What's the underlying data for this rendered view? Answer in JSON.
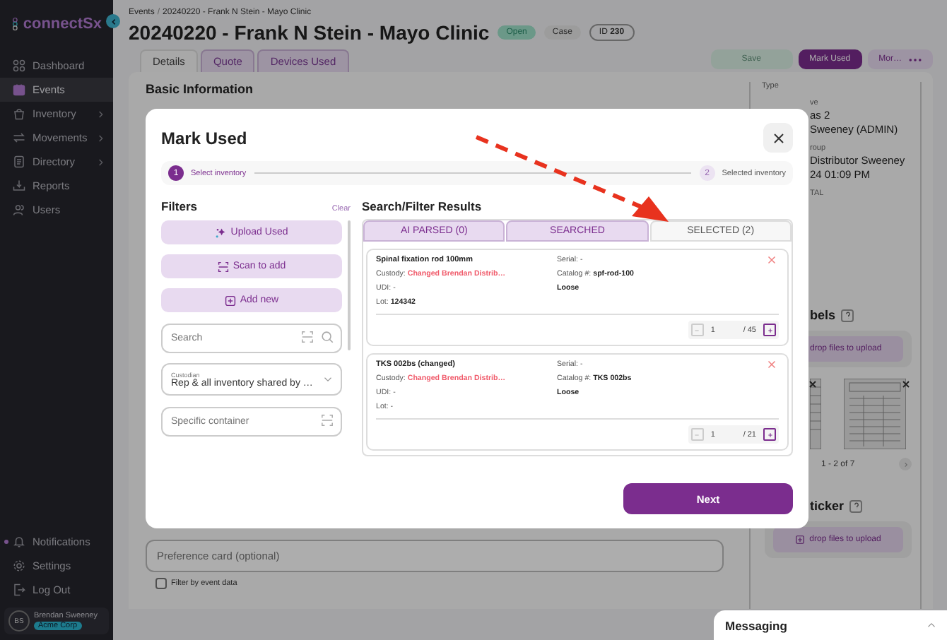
{
  "sidebar": {
    "logo": "connectSx",
    "items": [
      {
        "label": "Dashboard",
        "selected": false,
        "chevron": false
      },
      {
        "label": "Events",
        "selected": true,
        "chevron": false
      },
      {
        "label": "Inventory",
        "selected": false,
        "chevron": true
      },
      {
        "label": "Movements",
        "selected": false,
        "chevron": true
      },
      {
        "label": "Directory",
        "selected": false,
        "chevron": true
      },
      {
        "label": "Reports",
        "selected": false,
        "chevron": false
      },
      {
        "label": "Users",
        "selected": false,
        "chevron": false
      }
    ],
    "bottom_items": [
      {
        "label": "Notifications",
        "unread": true
      },
      {
        "label": "Settings",
        "unread": false
      },
      {
        "label": "Log Out",
        "unread": false
      }
    ],
    "user": {
      "initials": "BS",
      "name": "Brendan Sweeney",
      "org": "Acme Corp"
    }
  },
  "header": {
    "breadcrumb": [
      {
        "text": "Events",
        "kind": "link"
      },
      {
        "text": "/",
        "kind": "separator"
      },
      {
        "text": "20240220 - Frank N Stein - Mayo Clinic",
        "kind": "link"
      }
    ],
    "title": "20240220 - Frank N Stein - Mayo Clinic",
    "badges": [
      {
        "text": "Open",
        "kind": "status"
      },
      {
        "text": "Case",
        "kind": "plain"
      },
      {
        "text": "ID **230**",
        "kind": "outline"
      }
    ],
    "tabs": [
      {
        "label": "Details",
        "selected": true
      },
      {
        "label": "Quote",
        "selected": false
      },
      {
        "label": "Devices Used",
        "selected": false
      }
    ],
    "actions": [
      {
        "label": "Save",
        "kind": "save",
        "disabled": true
      },
      {
        "label": "Mark Used",
        "kind": "primary",
        "disabled": false
      },
      {
        "label": "Mor…",
        "kind": "more",
        "disabled": false
      }
    ]
  },
  "page": {
    "section_title": "Basic Information",
    "preference_placeholder": "Preference card (optional)",
    "filter_checkbox": {
      "label": "Filter by event data",
      "checked": false
    },
    "side_fields": [
      {
        "text": "Type",
        "kind": "label"
      },
      {
        "text": "ve",
        "kind": "label"
      },
      {
        "text": "as 2",
        "kind": "value"
      },
      {
        "text": "Sweeney (ADMIN)",
        "kind": "value"
      },
      {
        "text": "roup",
        "kind": "label"
      },
      {
        "text": "Distributor Sweeney",
        "kind": "value"
      },
      {
        "text": "24 01:09 PM",
        "kind": "value"
      },
      {
        "text": "TAL",
        "kind": "label"
      }
    ],
    "labels_title": "bels",
    "labels_upload": "drop files to upload",
    "labels_pager": "1 - 2 of 7",
    "sticker_title": "ticker",
    "sticker_upload": "drop files to upload"
  },
  "modal": {
    "title": "Mark Used",
    "steps": [
      {
        "number": "1",
        "label": "Select inventory",
        "selected": true
      },
      {
        "number": "2",
        "label": "Selected inventory",
        "selected": false
      }
    ],
    "filters": {
      "title": "Filters",
      "clear": "Clear",
      "buttons": [
        {
          "label": "Upload Used",
          "kind": "upload"
        },
        {
          "label": "Scan to add",
          "kind": "scan"
        },
        {
          "label": "Add new",
          "kind": "add"
        }
      ],
      "search_placeholder": "Search",
      "custodian_label": "Custodian",
      "custodian_value": "Rep & all inventory shared by …",
      "container_placeholder": "Specific container"
    },
    "results": {
      "title": "Search/Filter Results",
      "tabs": [
        {
          "label": "AI PARSED (0)",
          "selected": false
        },
        {
          "label": "SEARCHED",
          "selected": false
        },
        {
          "label": "SELECTED (2)",
          "selected": true
        }
      ],
      "items": [
        {
          "name": "Spinal fixation rod 100mm",
          "left": [
            {
              "text": "Custody: **Changed Brendan Distrib…**",
              "kind": "warn"
            },
            {
              "text": "UDI: -",
              "kind": "plain"
            },
            {
              "text": "Lot: **124342**",
              "kind": "plain"
            }
          ],
          "right": [
            {
              "text": "Serial: -",
              "kind": "plain"
            },
            {
              "text": "Catalog #: **spf-rod-100**",
              "kind": "plain"
            },
            {
              "text": "Loose",
              "kind": "bold"
            }
          ],
          "quantity": "1",
          "total": "/ 45"
        },
        {
          "name": "TKS 002bs (changed)",
          "left": [
            {
              "text": "Custody: **Changed Brendan Distrib…**",
              "kind": "warn"
            },
            {
              "text": "UDI: -",
              "kind": "plain"
            },
            {
              "text": "Lot: -",
              "kind": "plain"
            }
          ],
          "right": [
            {
              "text": "Serial: -",
              "kind": "plain"
            },
            {
              "text": "Catalog #: **TKS 002bs**",
              "kind": "plain"
            },
            {
              "text": "Loose",
              "kind": "bold"
            }
          ],
          "quantity": "1",
          "total": "/ 21"
        }
      ]
    },
    "next": "Next"
  },
  "messaging": {
    "title": "Messaging"
  }
}
